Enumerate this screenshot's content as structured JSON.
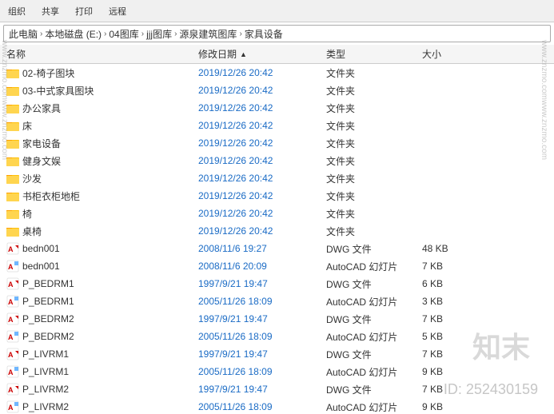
{
  "toolbar": {
    "groups_label": "组织",
    "share_label": "共享",
    "print_label": "打印",
    "more_label": "远程"
  },
  "addressbar": {
    "segments": [
      "本地磁盘 (E:)",
      "04图库",
      "jjj图库",
      "源泉建筑图库",
      "家具设备"
    ],
    "prefix": "此电脑"
  },
  "columns": {
    "name": "名称",
    "date": "修改日期",
    "type": "类型",
    "size": "大小"
  },
  "files": [
    {
      "name": "02-椅子图块",
      "date": "2019/12/26 20:42",
      "type": "文件夹",
      "size": "",
      "kind": "folder"
    },
    {
      "name": "03-中式家具图块",
      "date": "2019/12/26 20:42",
      "type": "文件夹",
      "size": "",
      "kind": "folder"
    },
    {
      "name": "办公家具",
      "date": "2019/12/26 20:42",
      "type": "文件夹",
      "size": "",
      "kind": "folder"
    },
    {
      "name": "床",
      "date": "2019/12/26 20:42",
      "type": "文件夹",
      "size": "",
      "kind": "folder"
    },
    {
      "name": "家电设备",
      "date": "2019/12/26 20:42",
      "type": "文件夹",
      "size": "",
      "kind": "folder"
    },
    {
      "name": "健身文娱",
      "date": "2019/12/26 20:42",
      "type": "文件夹",
      "size": "",
      "kind": "folder"
    },
    {
      "name": "沙发",
      "date": "2019/12/26 20:42",
      "type": "文件夹",
      "size": "",
      "kind": "folder"
    },
    {
      "name": "书柜衣柜地柜",
      "date": "2019/12/26 20:42",
      "type": "文件夹",
      "size": "",
      "kind": "folder"
    },
    {
      "name": "椅",
      "date": "2019/12/26 20:42",
      "type": "文件夹",
      "size": "",
      "kind": "folder"
    },
    {
      "name": "桌椅",
      "date": "2019/12/26 20:42",
      "type": "文件夹",
      "size": "",
      "kind": "folder"
    },
    {
      "name": "bedn001",
      "date": "2008/11/6 19:27",
      "type": "DWG 文件",
      "size": "48 KB",
      "kind": "dwg"
    },
    {
      "name": "bedn001",
      "date": "2008/11/6 20:09",
      "type": "AutoCAD 幻灯片",
      "size": "7 KB",
      "kind": "slide"
    },
    {
      "name": "P_BEDRM1",
      "date": "1997/9/21 19:47",
      "type": "DWG 文件",
      "size": "6 KB",
      "kind": "dwg"
    },
    {
      "name": "P_BEDRM1",
      "date": "2005/11/26 18:09",
      "type": "AutoCAD 幻灯片",
      "size": "3 KB",
      "kind": "slide"
    },
    {
      "name": "P_BEDRM2",
      "date": "1997/9/21 19:47",
      "type": "DWG 文件",
      "size": "7 KB",
      "kind": "dwg"
    },
    {
      "name": "P_BEDRM2",
      "date": "2005/11/26 18:09",
      "type": "AutoCAD 幻灯片",
      "size": "5 KB",
      "kind": "slide"
    },
    {
      "name": "P_LIVRM1",
      "date": "1997/9/21 19:47",
      "type": "DWG 文件",
      "size": "7 KB",
      "kind": "dwg"
    },
    {
      "name": "P_LIVRM1",
      "date": "2005/11/26 18:09",
      "type": "AutoCAD 幻灯片",
      "size": "9 KB",
      "kind": "slide"
    },
    {
      "name": "P_LIVRM2",
      "date": "1997/9/21 19:47",
      "type": "DWG 文件",
      "size": "7 KB",
      "kind": "dwg"
    },
    {
      "name": "P_LIVRM2",
      "date": "2005/11/26 18:09",
      "type": "AutoCAD 幻灯片",
      "size": "9 KB",
      "kind": "slide"
    }
  ],
  "watermarks": {
    "znzmo": "知末",
    "id": "ID: 252430159",
    "side_text": "www.znzmo.com"
  }
}
